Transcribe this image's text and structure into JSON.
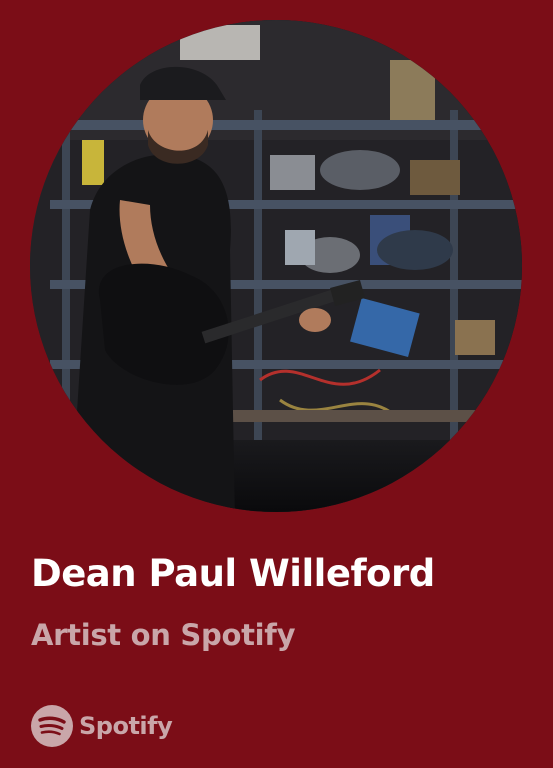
{
  "artist": {
    "name": "Dean Paul Willeford",
    "subtitle": "Artist on Spotify"
  },
  "brand": {
    "name": "Spotify",
    "icon": "spotify-logo-icon"
  },
  "colors": {
    "background": "#7b0d17",
    "title": "#ffffff",
    "muted": "#c9a6a9"
  }
}
